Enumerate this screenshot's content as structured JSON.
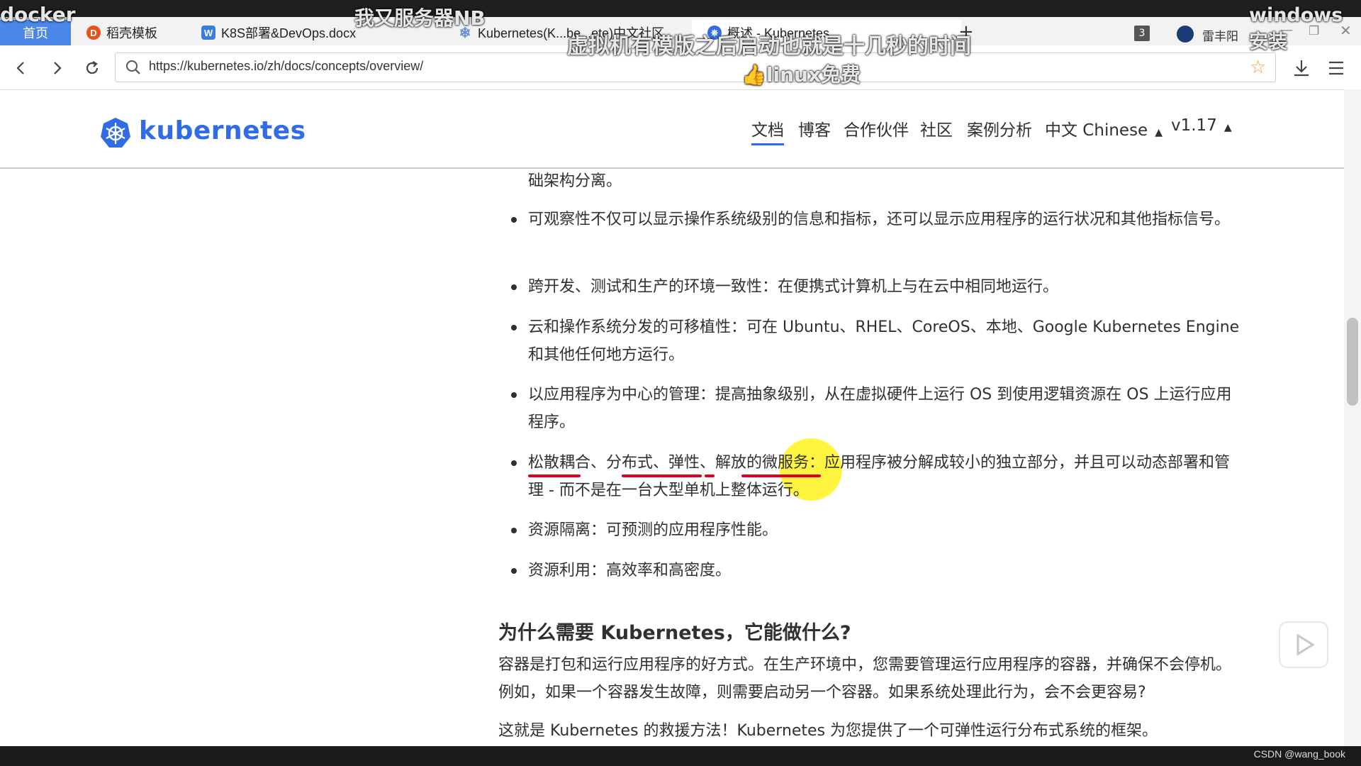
{
  "overlay": {
    "top_left": "docker",
    "top_center": "我又服务器NB",
    "top_right": "windows安装",
    "caption_1": "虚拟机有模版之后启动也就是十几秒的时间",
    "caption_2": "linux免费"
  },
  "tabs": [
    {
      "label": "首页"
    },
    {
      "label": "稻壳模板"
    },
    {
      "label": "K8S部署&DevOps.docx"
    },
    {
      "label": "Kubernetes(K...be...ete)中文社区"
    },
    {
      "label": "概述 - Kubernetes"
    }
  ],
  "tab_count": "3",
  "user_name": "雷丰阳",
  "url": "https://kubernetes.io/zh/docs/concepts/overview/",
  "site": {
    "logo": "kubernetes",
    "nav": [
      "文档",
      "博客",
      "合作伙伴",
      "社区",
      "案例分析",
      "中文 Chinese",
      "v1.17"
    ]
  },
  "content": {
    "frag": "础架构分离。",
    "bullets": [
      "可观察性不仅可以显示操作系统级别的信息和指标，还可以显示应用程序的运行状况和其他指标信号。",
      "跨开发、测试和生产的环境一致性：在便携式计算机上与在云中相同地运行。",
      "云和操作系统分发的可移植性：可在 Ubuntu、RHEL、CoreOS、本地、Google Kubernetes Engine 和其他任何地方运行。",
      "以应用程序为中心的管理：提高抽象级别，从在虚拟硬件上运行 OS 到使用逻辑资源在 OS 上运行应用程序。",
      "松散耦合、分布式、弹性、解放的微服务：应用程序被分解成较小的独立部分，并且可以动态部署和管理 - 而不是在一台大型单机上整体运行。",
      "资源隔离：可预测的应用程序性能。",
      "资源利用：高效率和高密度。"
    ],
    "heading": "为什么需要 Kubernetes，它能做什么?",
    "para1": "容器是打包和运行应用程序的好方式。在生产环境中，您需要管理运行应用程序的容器，并确保不会停机。例如，如果一个容器发生故障，则需要启动另一个容器。如果系统处理此行为，会不会更容易?",
    "para2": "这就是 Kubernetes 的救援方法！Kubernetes 为您提供了一个可弹性运行分布式系统的框架。Kubernetes"
  },
  "watermark": "CSDN @wang_book",
  "colors": {
    "accent": "#326ce5",
    "underline": "#e0001b",
    "highlight": "#fff000"
  }
}
